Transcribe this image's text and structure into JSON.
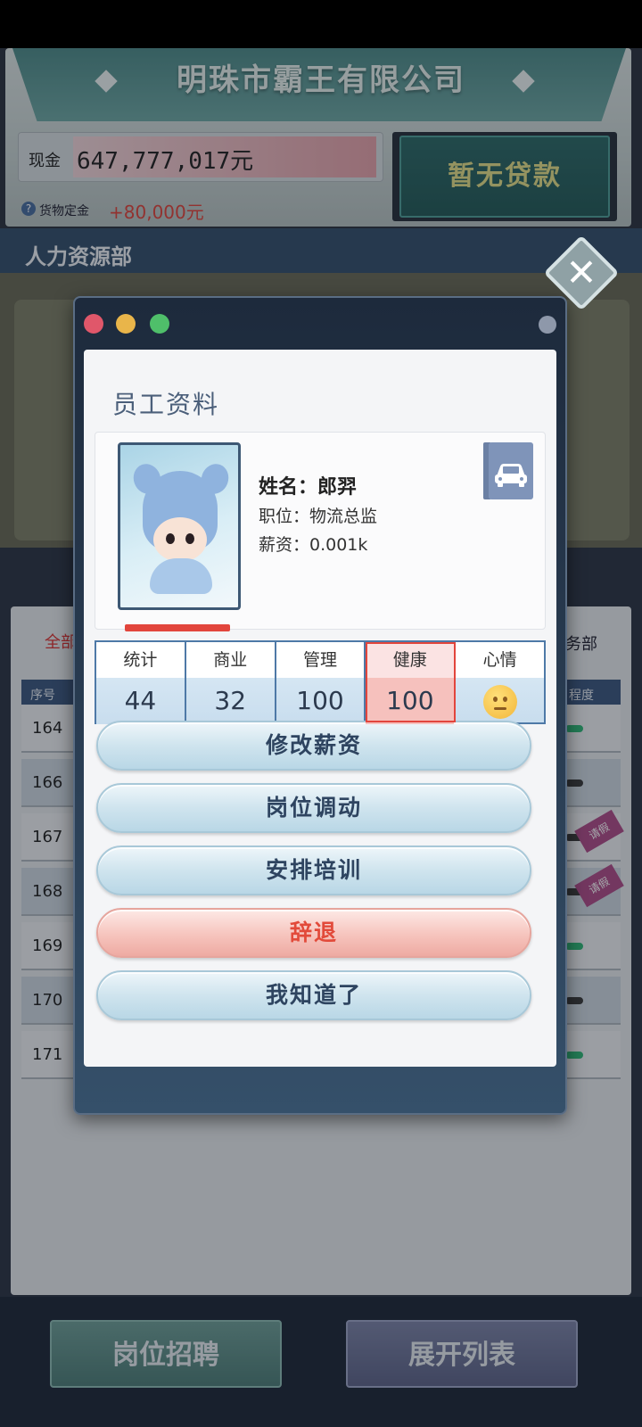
{
  "company": {
    "name": "明珠市霸王有限公司",
    "cash_label": "现金",
    "cash_value": "647,777,017元",
    "deposit_label": "货物定金",
    "deposit_value": "+80,000元",
    "help_icon": "?",
    "loan_label": "暂无贷款"
  },
  "department": {
    "title": "人力资源部"
  },
  "background_list": {
    "tab_left": "全部",
    "tab_right": "务部",
    "col_index": "序号",
    "col_right": "程度",
    "rows": [
      "164",
      "166",
      "167",
      "168",
      "169",
      "170",
      "171"
    ],
    "leave_tag": "请假"
  },
  "bottom": {
    "recruit_label": "岗位招聘",
    "expand_label": "展开列表"
  },
  "modal": {
    "title": "员工资料",
    "employee": {
      "name": "姓名：郎羿",
      "position": "职位：物流总监",
      "salary": "薪资：0.001k"
    },
    "stats": [
      {
        "label": "统计",
        "value": "44"
      },
      {
        "label": "商业",
        "value": "32"
      },
      {
        "label": "管理",
        "value": "100"
      },
      {
        "label": "健康",
        "value": "100"
      },
      {
        "label": "心情",
        "icon": "neutral-face-icon"
      }
    ],
    "buttons": {
      "change_salary": "修改薪资",
      "transfer": "岗位调动",
      "training": "安排培训",
      "dismiss": "辞退",
      "acknowledge": "我知道了"
    }
  },
  "colors": {
    "accent_red": "#e2453c",
    "frame_blue": "#4e79a7",
    "loan_text": "#e6e18a"
  }
}
